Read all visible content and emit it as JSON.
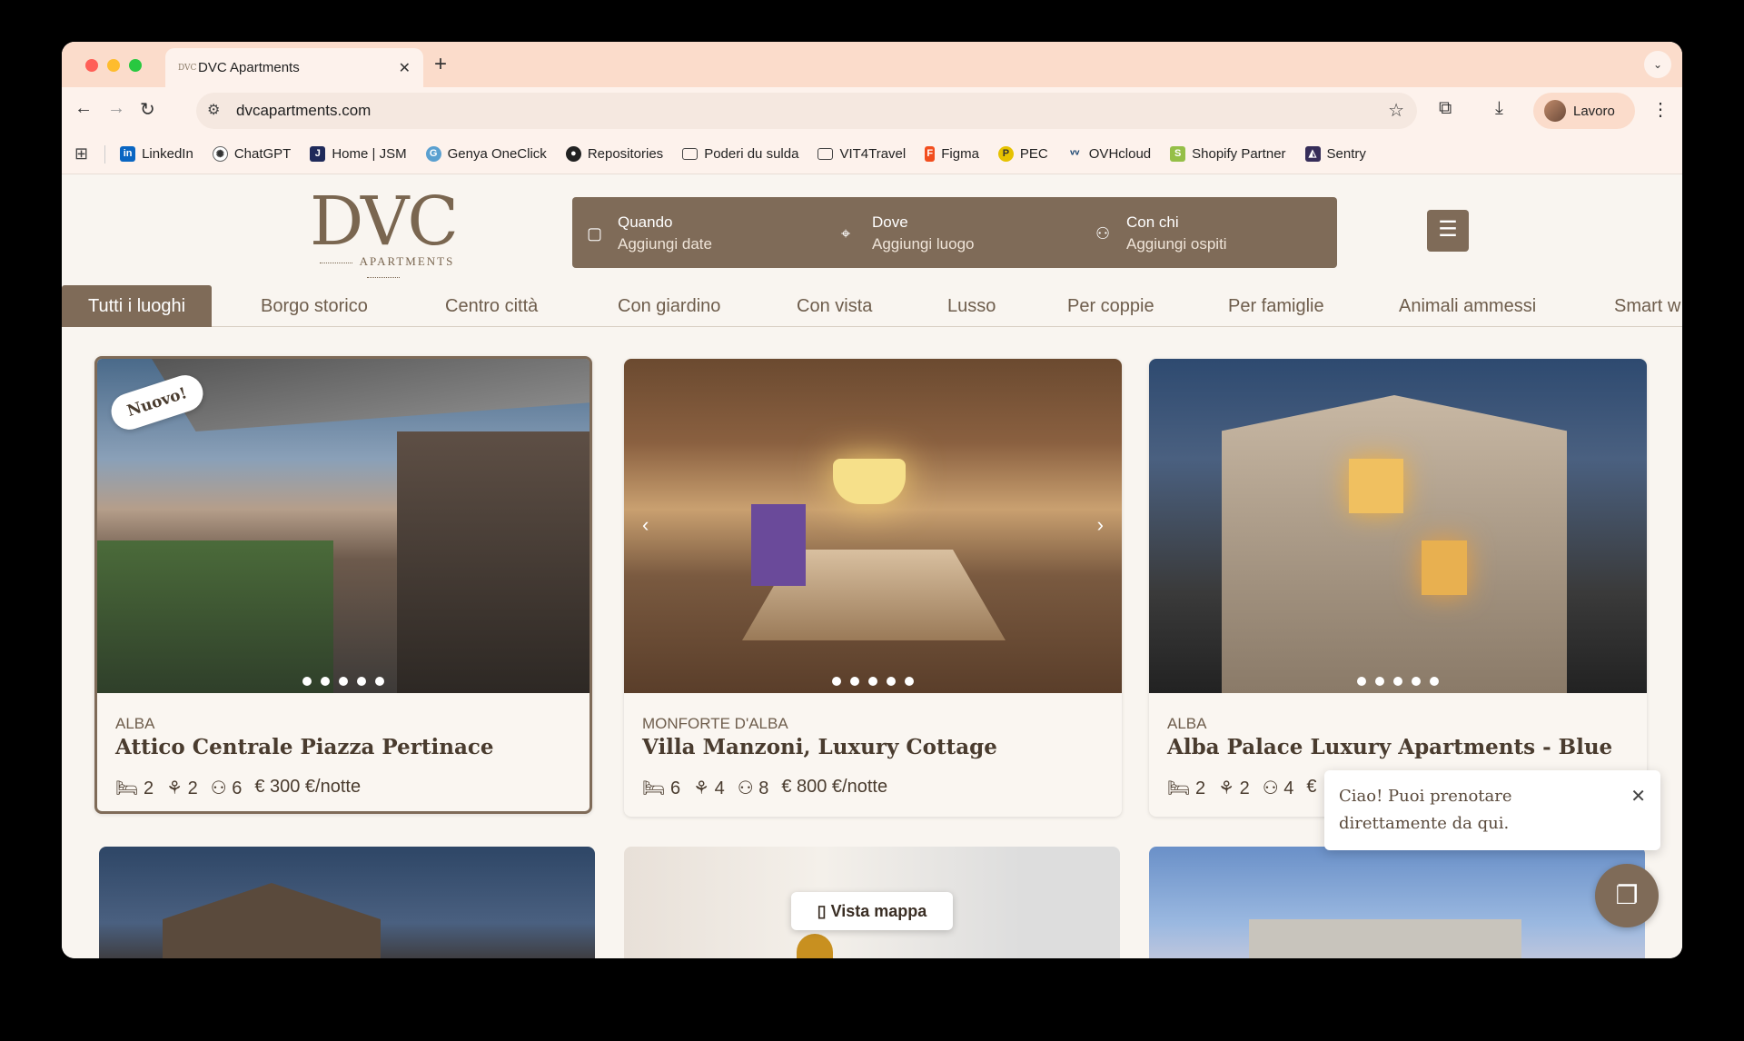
{
  "browser": {
    "tab_title": "DVC Apartments",
    "tab_favicon": "DVC",
    "url": "dvcapartments.com",
    "profile_name": "Lavoro",
    "bookmarks": [
      {
        "label": "LinkedIn",
        "icon": "linkedin-icon",
        "color": "#0a66c2"
      },
      {
        "label": "ChatGPT",
        "icon": "chatgpt-icon",
        "color": "#444444"
      },
      {
        "label": "Home | JSM",
        "icon": "jsm-icon",
        "color": "#1f2a5a"
      },
      {
        "label": "Genya OneClick",
        "icon": "genya-icon",
        "color": "#5aa0d0"
      },
      {
        "label": "Repositories",
        "icon": "github-icon",
        "color": "#222222"
      },
      {
        "label": "Poderi du sulda",
        "icon": "folder-icon",
        "color": "#444444"
      },
      {
        "label": "VIT4Travel",
        "icon": "folder-icon",
        "color": "#444444"
      },
      {
        "label": "Figma",
        "icon": "figma-icon",
        "color": "#f24e1e"
      },
      {
        "label": "PEC",
        "icon": "pec-icon",
        "color": "#e6c200"
      },
      {
        "label": "OVHcloud",
        "icon": "ovh-icon",
        "color": "#123f6d"
      },
      {
        "label": "Shopify Partner",
        "icon": "shopify-icon",
        "color": "#95bf47"
      },
      {
        "label": "Sentry",
        "icon": "sentry-icon",
        "color": "#362d59"
      }
    ]
  },
  "site": {
    "logo_main": "DVC",
    "logo_sub": "APARTMENTS",
    "search": {
      "when_label": "Quando",
      "when_value": "Aggiungi date",
      "where_label": "Dove",
      "where_value": "Aggiungi luogo",
      "who_label": "Con chi",
      "who_value": "Aggiungi ospiti"
    },
    "categories": [
      "Tutti i luoghi",
      "Borgo storico",
      "Centro città",
      "Con giardino",
      "Con vista",
      "Lusso",
      "Per coppie",
      "Per famiglie",
      "Animali ammessi",
      "Smart w"
    ],
    "listings": [
      {
        "badge": "Nuovo!",
        "location": "ALBA",
        "name": "Attico Centrale Piazza Pertinace",
        "beds": "2",
        "baths": "2",
        "guests": "6",
        "price": "€ 300 €/notte"
      },
      {
        "location": "MONFORTE D'ALBA",
        "name": "Villa Manzoni, Luxury Cottage",
        "beds": "6",
        "baths": "4",
        "guests": "8",
        "price": "€ 800 €/notte"
      },
      {
        "location": "ALBA",
        "name": "Alba Palace Luxury Apartments - Blue",
        "beds": "2",
        "baths": "2",
        "guests": "4",
        "price": "€"
      }
    ],
    "map_button": "Vista mappa",
    "chat_popup": "Ciao! Puoi prenotare direttamente da qui.",
    "accent_color": "#7f6b58"
  }
}
